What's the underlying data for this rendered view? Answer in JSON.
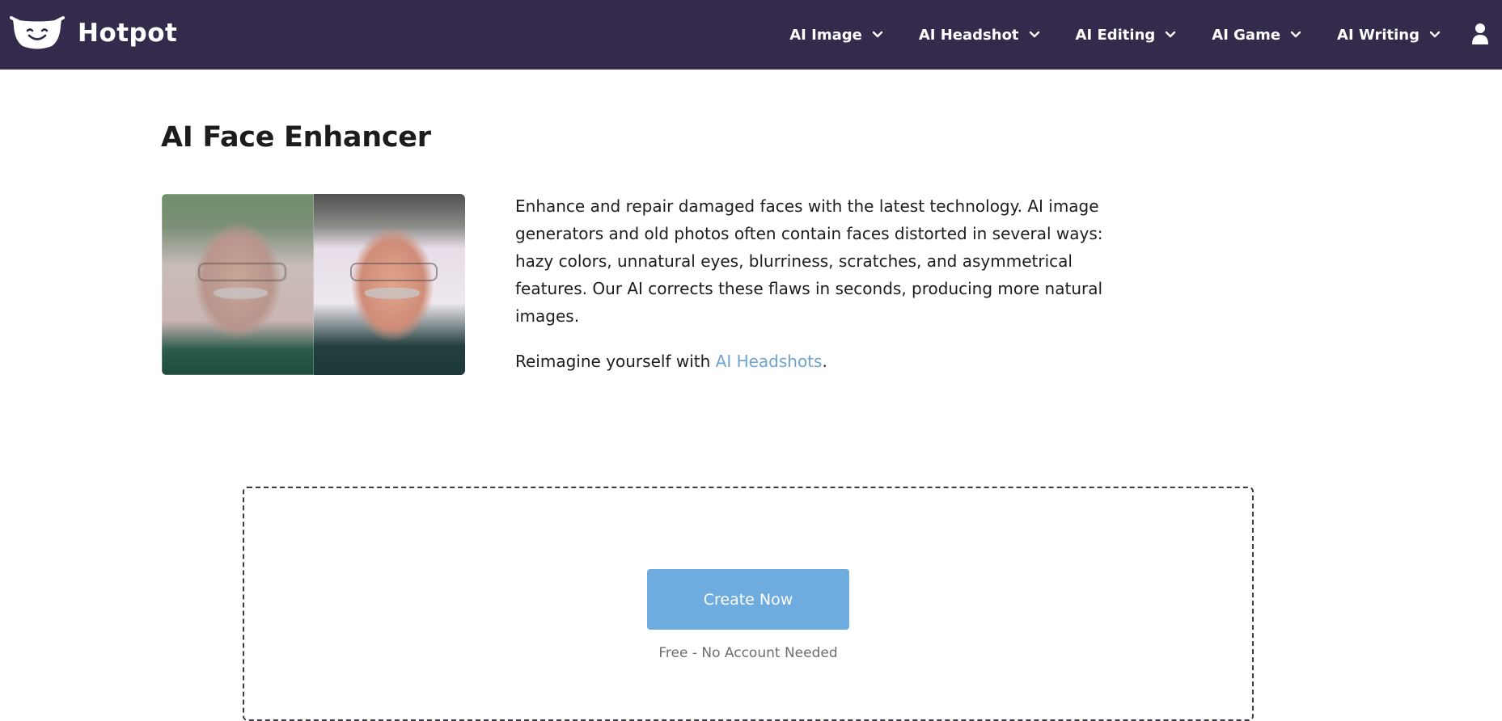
{
  "header": {
    "brand_name": "Hotpot",
    "brand_icon": "smiling-pot-logo",
    "background_color": "#342a4b",
    "nav": [
      {
        "label": "AI Image"
      },
      {
        "label": "AI Headshot"
      },
      {
        "label": "AI Editing"
      },
      {
        "label": "AI Game"
      },
      {
        "label": "AI Writing"
      }
    ],
    "user_icon": "user-icon"
  },
  "main": {
    "title": "AI Face Enhancer",
    "description_lines": [
      "Enhance and repair damaged faces with the latest technology. AI image",
      "generators and old photos often contain faces distorted in several ways:",
      "hazy colors, unnatural eyes, blurriness, scratches, and asymmetrical",
      "features. Our AI corrects these flaws in seconds, producing more natural",
      "images."
    ],
    "reimagine_prefix": "Reimagine yourself with ",
    "reimagine_link": "AI Headshots",
    "reimagine_suffix": ".",
    "link_color": "#6ea4cf"
  },
  "upload": {
    "button_label": "Create Now",
    "button_color": "#6eace0",
    "note": "Free - No Account Needed"
  }
}
